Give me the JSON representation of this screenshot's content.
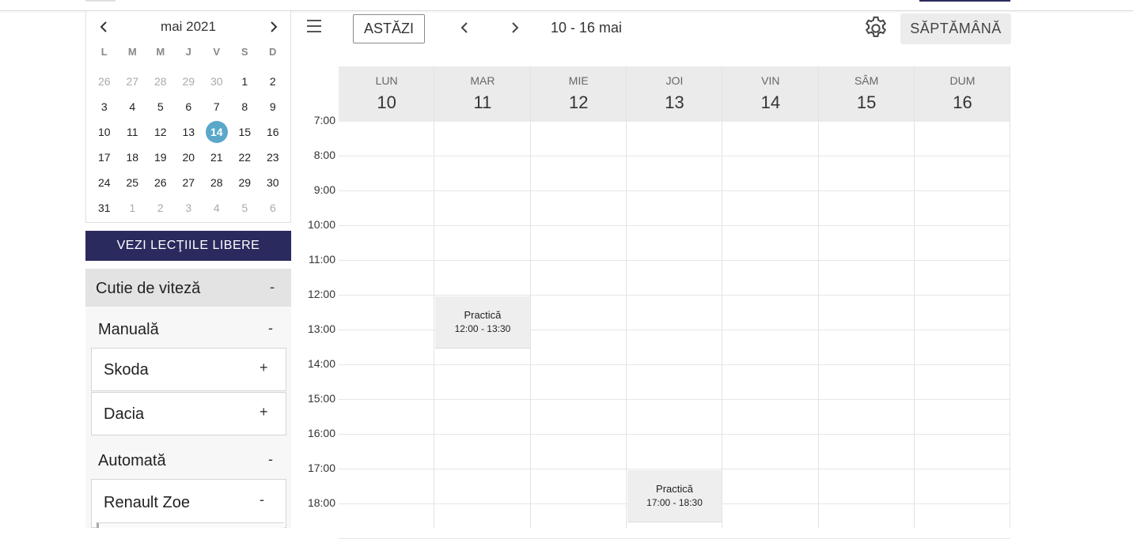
{
  "mini_calendar": {
    "title": "mai 2021",
    "weekdays": [
      "L",
      "M",
      "M",
      "J",
      "V",
      "S",
      "D"
    ],
    "days": [
      {
        "d": "26",
        "muted": true
      },
      {
        "d": "27",
        "muted": true
      },
      {
        "d": "28",
        "muted": true
      },
      {
        "d": "29",
        "muted": true
      },
      {
        "d": "30",
        "muted": true
      },
      {
        "d": "1"
      },
      {
        "d": "2"
      },
      {
        "d": "3"
      },
      {
        "d": "4"
      },
      {
        "d": "5"
      },
      {
        "d": "6"
      },
      {
        "d": "7"
      },
      {
        "d": "8"
      },
      {
        "d": "9"
      },
      {
        "d": "10"
      },
      {
        "d": "11"
      },
      {
        "d": "12"
      },
      {
        "d": "13"
      },
      {
        "d": "14",
        "selected": true
      },
      {
        "d": "15"
      },
      {
        "d": "16"
      },
      {
        "d": "17"
      },
      {
        "d": "18"
      },
      {
        "d": "19"
      },
      {
        "d": "20"
      },
      {
        "d": "21"
      },
      {
        "d": "22"
      },
      {
        "d": "23"
      },
      {
        "d": "24"
      },
      {
        "d": "25"
      },
      {
        "d": "26"
      },
      {
        "d": "27"
      },
      {
        "d": "28"
      },
      {
        "d": "29"
      },
      {
        "d": "30"
      },
      {
        "d": "31"
      },
      {
        "d": "1",
        "muted": true
      },
      {
        "d": "2",
        "muted": true
      },
      {
        "d": "3",
        "muted": true
      },
      {
        "d": "4",
        "muted": true
      },
      {
        "d": "5",
        "muted": true
      },
      {
        "d": "6",
        "muted": true
      }
    ]
  },
  "free_lessons_button": "VEZI LECŢIILE LIBERE",
  "filters": {
    "gearbox": {
      "label": "Cutie de viteză",
      "toggle": "-"
    },
    "manual": {
      "label": "Manuală",
      "toggle": "-"
    },
    "cars_manual": [
      {
        "label": "Skoda",
        "toggle": "+"
      },
      {
        "label": "Dacia",
        "toggle": "+"
      }
    ],
    "automatic": {
      "label": "Automată",
      "toggle": "-"
    },
    "cars_automatic": [
      {
        "label": "Renault Zoe",
        "toggle": "-"
      }
    ]
  },
  "toolbar": {
    "today": "ASTĂZI",
    "range": "10 - 16 mai",
    "view": "SĂPTĂMÂNĂ"
  },
  "week": {
    "days": [
      {
        "wd": "LUN",
        "dn": "10"
      },
      {
        "wd": "MAR",
        "dn": "11"
      },
      {
        "wd": "MIE",
        "dn": "12"
      },
      {
        "wd": "JOI",
        "dn": "13"
      },
      {
        "wd": "VIN",
        "dn": "14"
      },
      {
        "wd": "SÂM",
        "dn": "15"
      },
      {
        "wd": "DUM",
        "dn": "16"
      }
    ],
    "hours": [
      "7:00",
      "8:00",
      "9:00",
      "10:00",
      "11:00",
      "12:00",
      "13:00",
      "14:00",
      "15:00",
      "16:00",
      "17:00",
      "18:00"
    ],
    "events": [
      {
        "day": 1,
        "start": 12,
        "end": 13.5,
        "title": "Practică",
        "time": "12:00 - 13:30"
      },
      {
        "day": 3,
        "start": 17,
        "end": 18.5,
        "title": "Practică",
        "time": "17:00 - 18:30"
      }
    ]
  },
  "colors": {
    "accent": "#2b2a5e",
    "selected_day": "#5aa8c9",
    "event_bg": "#eeeeee"
  }
}
